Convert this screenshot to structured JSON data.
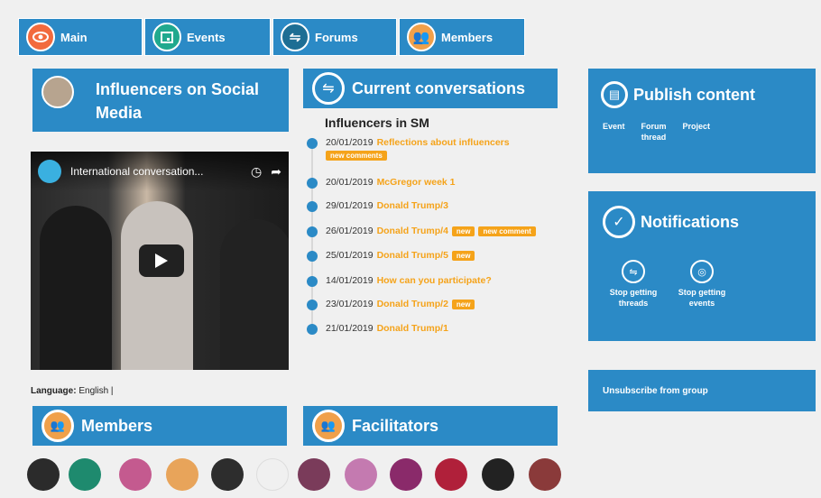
{
  "tabs": [
    {
      "label": "Main",
      "icon": "eye-icon"
    },
    {
      "label": "Events",
      "icon": "calendar-icon"
    },
    {
      "label": "Forums",
      "icon": "forum-icon"
    },
    {
      "label": "Members",
      "icon": "members-icon"
    }
  ],
  "group": {
    "title": "Influencers on Social Media"
  },
  "video": {
    "title": "International conversation...",
    "language_label": "Language:",
    "language_value": "English |"
  },
  "conversations": {
    "title": "Current conversations",
    "subtitle": "Influencers in SM",
    "items": [
      {
        "date": "20/01/2019",
        "title": "Reflections about influencers",
        "badges": [
          "new comments"
        ]
      },
      {
        "date": "20/01/2019",
        "title": "McGregor week 1",
        "badges": []
      },
      {
        "date": "29/01/2019",
        "title": "Donald Trump/3",
        "badges": []
      },
      {
        "date": "26/01/2019",
        "title": "Donald Trump/4",
        "badges": [
          "new",
          "new comment"
        ]
      },
      {
        "date": "25/01/2019",
        "title": "Donald Trump/5",
        "badges": [
          "new"
        ]
      },
      {
        "date": "14/01/2019",
        "title": "How can you participate?",
        "badges": []
      },
      {
        "date": "23/01/2019",
        "title": "Donald Trump/2",
        "badges": [
          "new"
        ]
      },
      {
        "date": "21/01/2019",
        "title": "Donald Trump/1",
        "badges": []
      }
    ]
  },
  "publish": {
    "title": "Publish content",
    "links": [
      "Event",
      "Forum thread",
      "Project"
    ]
  },
  "notifications": {
    "title": "Notifications",
    "stop_threads": "Stop getting threads",
    "stop_events": "Stop getting events"
  },
  "unsubscribe": {
    "label": "Unsubscribe from group"
  },
  "members": {
    "title": "Members"
  },
  "facilitators": {
    "title": "Facilitators"
  },
  "colors": {
    "primary": "#2b8ac6",
    "accent": "#f5a31a",
    "background": "#f0f0f0"
  }
}
